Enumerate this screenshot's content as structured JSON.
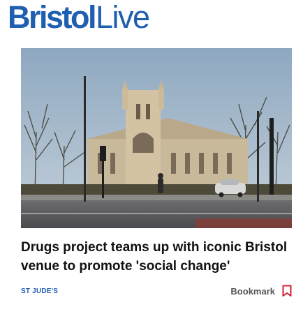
{
  "header": {
    "logo_part1": "Bristol",
    "logo_part2": "Live",
    "brand_color": "#1f5fb1"
  },
  "article": {
    "image_alt": "St Jude's church Bristol",
    "headline": "Drugs project teams up with iconic Bristol venue to promote 'social change'",
    "tag": "ST JUDE'S",
    "bookmark_label": "Bookmark",
    "bookmark_icon": "bookmark-icon",
    "bookmark_color": "#d1203a"
  }
}
